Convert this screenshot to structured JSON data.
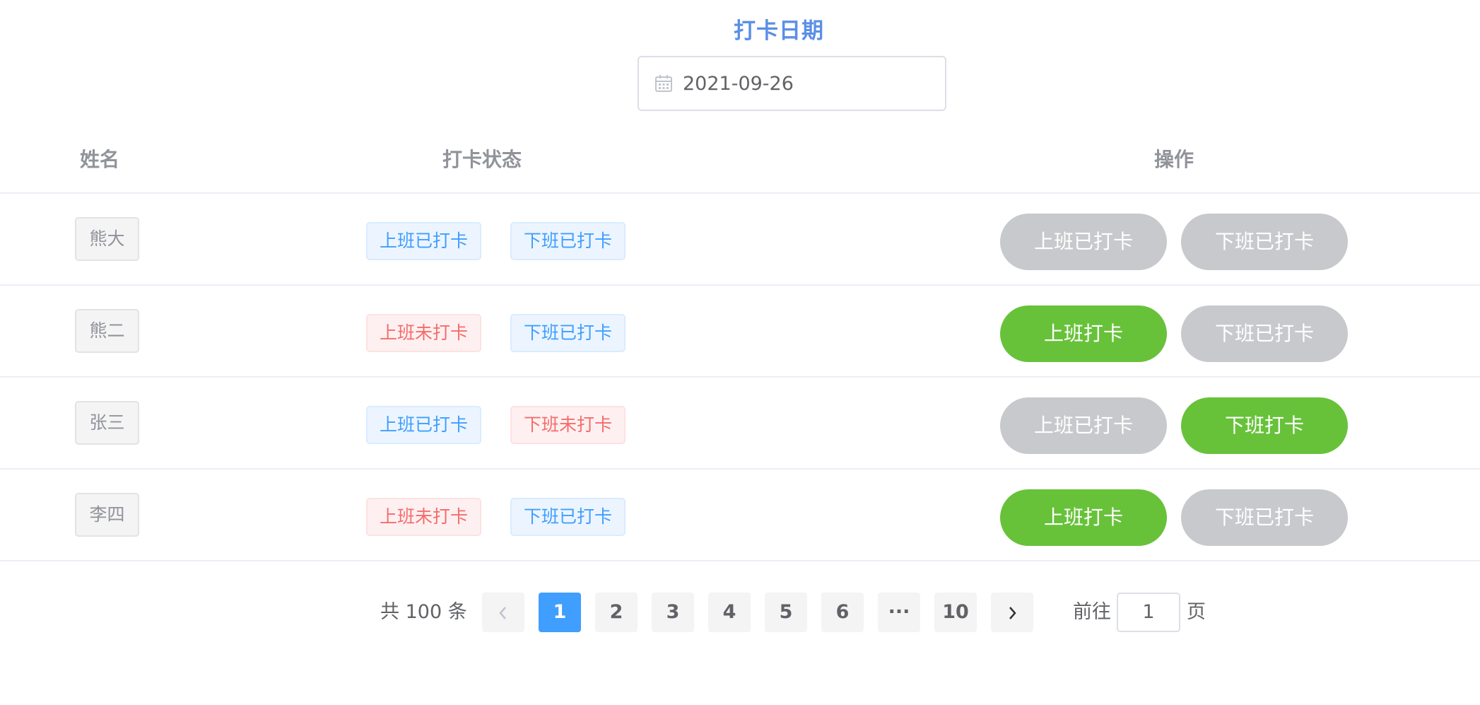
{
  "header": {
    "title": "打卡日期"
  },
  "date_picker": {
    "value": "2021-09-26",
    "icon": "calendar-icon"
  },
  "table": {
    "columns": [
      "姓名",
      "打卡状态",
      "操作"
    ],
    "rows": [
      {
        "name": "熊大",
        "am_status": "上班已打卡",
        "pm_status": "下班已打卡",
        "am_action": "上班已打卡",
        "pm_action": "下班已打卡"
      },
      {
        "name": "熊二",
        "am_status": "上班未打卡",
        "pm_status": "下班已打卡",
        "am_action": "上班打卡",
        "pm_action": "下班已打卡"
      },
      {
        "name": "张三",
        "am_status": "上班已打卡",
        "pm_status": "下班未打卡",
        "am_action": "上班已打卡",
        "pm_action": "下班打卡"
      },
      {
        "name": "李四",
        "am_status": "上班未打卡",
        "pm_status": "下班已打卡",
        "am_action": "上班打卡",
        "pm_action": "下班已打卡"
      }
    ]
  },
  "pagination": {
    "total": "共 100 条",
    "prev": "‹",
    "pages": [
      "1",
      "2",
      "3",
      "4",
      "5",
      "6",
      "···",
      "10"
    ],
    "current": "1",
    "next": "›",
    "goto_prefix": "前往",
    "goto_value": "1",
    "goto_suffix": "页"
  },
  "colors": {
    "primary": "#409eff",
    "success": "#67c23a",
    "danger": "#f56c6c",
    "disabled": "#c8c9cc",
    "title": "#5b8fe6"
  }
}
